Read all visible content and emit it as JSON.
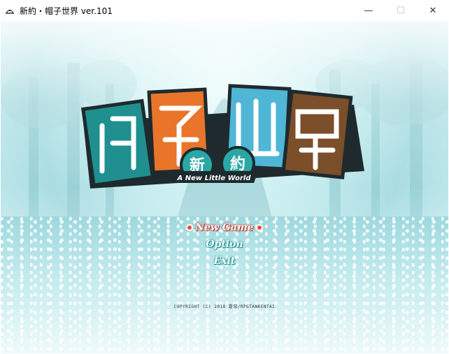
{
  "window": {
    "title": "新約・帽子世界 ver.101",
    "controls": {
      "minimize": "—",
      "maximize": "☐",
      "close": "✕"
    }
  },
  "logo": {
    "main_title": "帽子世界",
    "badge": "新約",
    "subtitle": "A New Little World"
  },
  "menu": {
    "items": [
      {
        "label": "New Game",
        "selected": true
      },
      {
        "label": "Option",
        "selected": false
      },
      {
        "label": "Exit",
        "selected": false
      }
    ]
  },
  "footer": {
    "copyright": "COPYRIGHT (C) 2018 蒼穹/RPGTANKENTAI"
  },
  "colors": {
    "selected_outline": "#c0392b",
    "menu_outline": "#1a9aa0",
    "logo_teal": "#1f8f8f",
    "logo_orange": "#e8752a"
  },
  "icons": {
    "app": "hat-icon"
  }
}
